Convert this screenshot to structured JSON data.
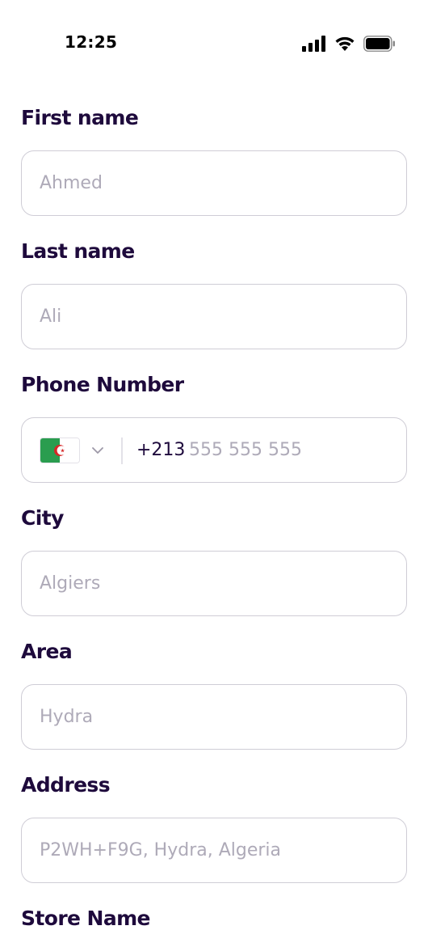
{
  "status_bar": {
    "time": "12:25",
    "icons": [
      "cellular-signal-icon",
      "wifi-icon",
      "battery-icon"
    ]
  },
  "form": {
    "first_name": {
      "label": "First name",
      "placeholder": "Ahmed"
    },
    "last_name": {
      "label": "Last name",
      "placeholder": "Ali"
    },
    "phone": {
      "label": "Phone Number",
      "country_flag": "algeria-flag-icon",
      "dial_code": "+213",
      "placeholder": "555 555 555"
    },
    "city": {
      "label": "City",
      "placeholder": "Algiers"
    },
    "area": {
      "label": "Area",
      "placeholder": "Hydra"
    },
    "address": {
      "label": "Address",
      "placeholder": "P2WH+F9G, Hydra, Algeria"
    },
    "store_name": {
      "label": "Store Name"
    }
  },
  "colors": {
    "label": "#1e0a3c",
    "placeholder": "#aeaab8",
    "border": "#cfcdd6",
    "flag_green": "#2a9d4f",
    "flag_red": "#d62828"
  }
}
